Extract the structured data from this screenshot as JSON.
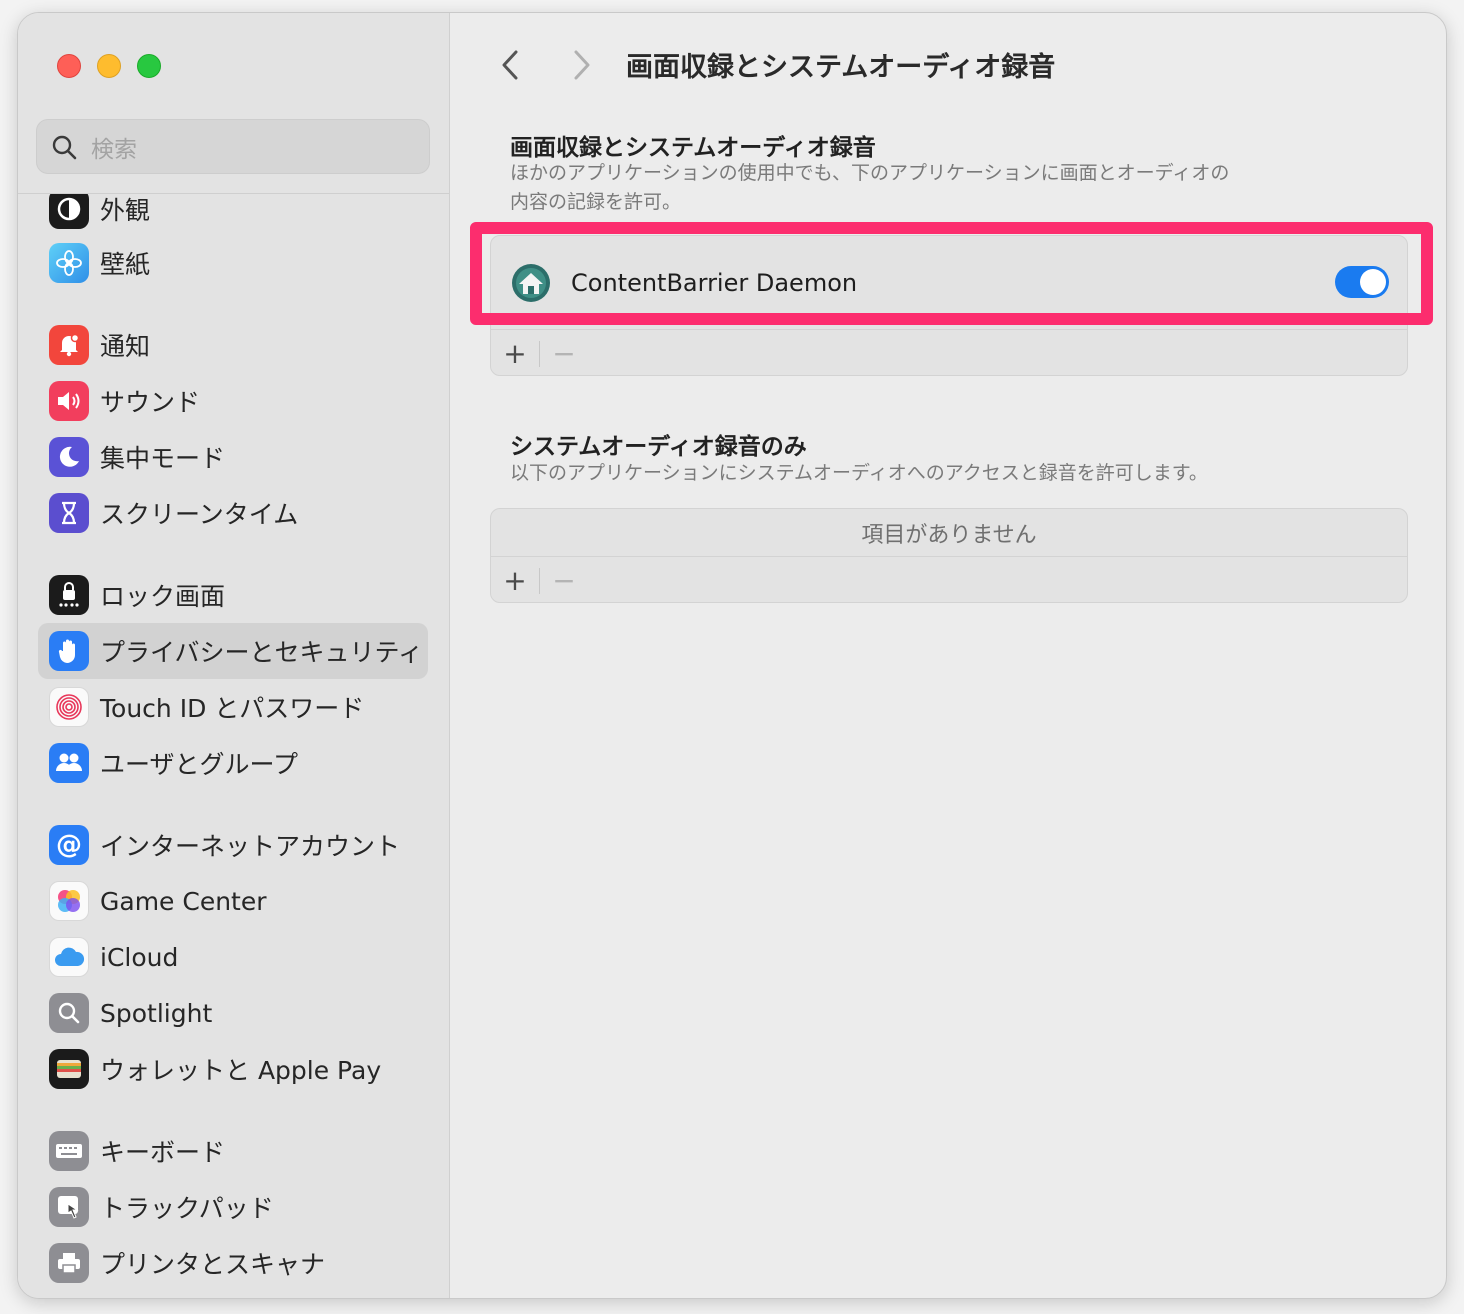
{
  "search": {
    "placeholder": "検索"
  },
  "sidebar": {
    "items": [
      {
        "label": "外観",
        "icon": "appearance-icon",
        "color": "#1b1b1b"
      },
      {
        "label": "壁紙",
        "icon": "wallpaper-icon",
        "color": "#3ab8f2"
      },
      {
        "label": "通知",
        "icon": "notifications-icon",
        "color": "#f2463c"
      },
      {
        "label": "サウンド",
        "icon": "sound-icon",
        "color": "#f23e5d"
      },
      {
        "label": "集中モード",
        "icon": "focus-icon",
        "color": "#5a52d6"
      },
      {
        "label": "スクリーンタイム",
        "icon": "screen-time-icon",
        "color": "#5b4ecf"
      },
      {
        "label": "ロック画面",
        "icon": "lock-screen-icon",
        "color": "#1b1b1b"
      },
      {
        "label": "プライバシーとセキュリティ",
        "icon": "privacy-hand-icon",
        "color": "#2a7df5",
        "selected": true
      },
      {
        "label": "Touch ID とパスワード",
        "icon": "fingerprint-icon",
        "color": "#f5f5f5"
      },
      {
        "label": "ユーザとグループ",
        "icon": "users-icon",
        "color": "#2a7df5"
      },
      {
        "label": "インターネットアカウント",
        "icon": "at-icon",
        "color": "#2a7df5"
      },
      {
        "label": "Game Center",
        "icon": "game-center-icon",
        "color": "#f5f5f5"
      },
      {
        "label": "iCloud",
        "icon": "icloud-icon",
        "color": "#f5f5f5"
      },
      {
        "label": "Spotlight",
        "icon": "spotlight-icon",
        "color": "#8e8e93"
      },
      {
        "label": "ウォレットと Apple Pay",
        "icon": "wallet-icon",
        "color": "#1b1b1b"
      },
      {
        "label": "キーボード",
        "icon": "keyboard-icon",
        "color": "#8e8e93"
      },
      {
        "label": "トラックパッド",
        "icon": "trackpad-icon",
        "color": "#8e8e93"
      },
      {
        "label": "プリンタとスキャナ",
        "icon": "printer-icon",
        "color": "#8e8e93"
      }
    ]
  },
  "main": {
    "title": "画面収録とシステムオーディオ録音",
    "section1": {
      "heading": "画面収録とシステムオーディオ録音",
      "desc_line1": "ほかのアプリケーションの使用中でも、下のアプリケーションに画面とオーディオの",
      "desc_line2": "内容の記録を許可。",
      "app_name": "ContentBarrier Daemon",
      "toggle_on": true
    },
    "section2": {
      "heading": "システムオーディオ録音のみ",
      "desc": "以下のアプリケーションにシステムオーディオへのアクセスと録音を許可します。",
      "empty_text": "項目がありません"
    },
    "buttons": {
      "plus": "+",
      "minus": "−"
    }
  },
  "colors": {
    "accent": "#1a7bf0",
    "highlight": "#fc2d6e"
  }
}
